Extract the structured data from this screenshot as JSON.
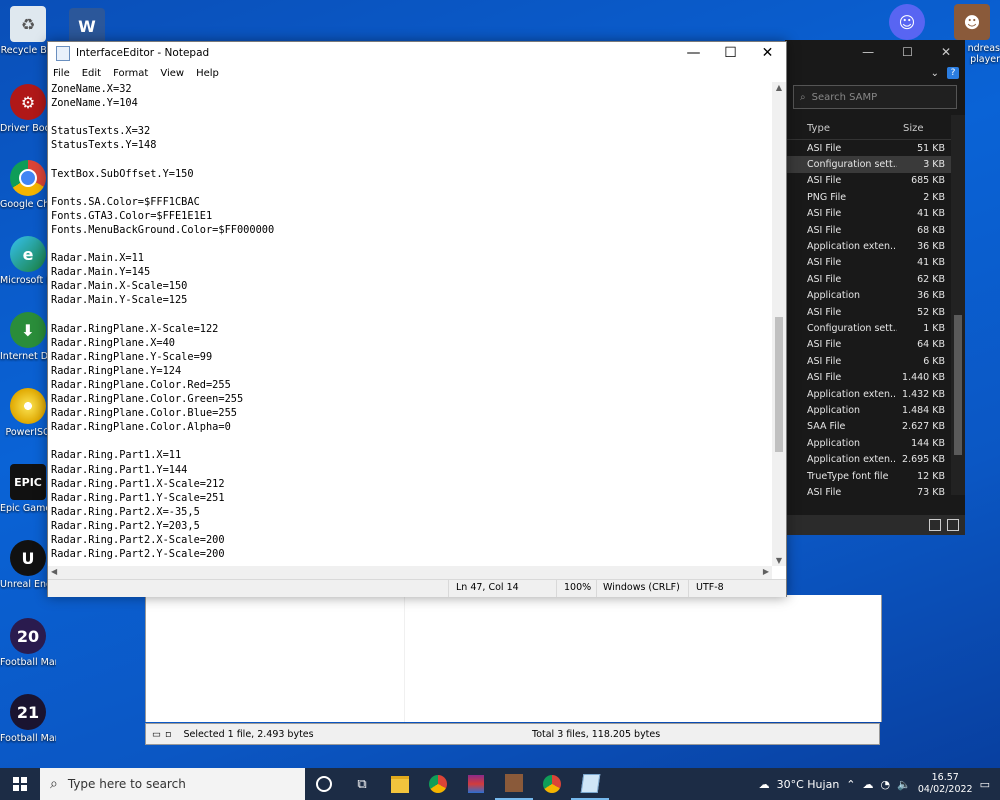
{
  "desktop": {
    "icons": [
      {
        "label": "Recycle Bin",
        "icon": "recycle-bin-icon"
      },
      {
        "label": "Driver Booster",
        "icon": "driver-booster-icon"
      },
      {
        "label": "Google Chrome",
        "icon": "chrome-icon"
      },
      {
        "label": "Microsoft Edge",
        "icon": "edge-icon"
      },
      {
        "label": "Internet Downlo...",
        "icon": "idm-icon"
      },
      {
        "label": "PowerISO",
        "icon": "poweriso-icon"
      },
      {
        "label": "Epic Games Launcher",
        "icon": "epic-games-icon",
        "badge": "EPIC"
      },
      {
        "label": "Unreal Engine",
        "icon": "unreal-engine-icon"
      },
      {
        "label": "Football Manag...",
        "icon": "football-manager-20-icon",
        "badge": "20"
      },
      {
        "label": "Football Manag...",
        "icon": "football-manager-21-icon",
        "badge": "21"
      }
    ],
    "top_icons": [
      {
        "label": "",
        "icon": "word-icon",
        "badge": "W"
      },
      {
        "label": "",
        "icon": "discord-icon"
      },
      {
        "label": "ndreas\nplayer",
        "icon": "samp-player-icon"
      }
    ]
  },
  "explorer": {
    "search_placeholder": "Search SAMP",
    "col_type": "Type",
    "col_size": "Size",
    "files": [
      {
        "type": "ASI File",
        "size": "51 KB"
      },
      {
        "type": "Configuration sett...",
        "size": "3 KB",
        "selected": true
      },
      {
        "type": "ASI File",
        "size": "685 KB"
      },
      {
        "type": "PNG File",
        "size": "2 KB"
      },
      {
        "type": "ASI File",
        "size": "41 KB"
      },
      {
        "type": "ASI File",
        "size": "68 KB"
      },
      {
        "type": "Application exten...",
        "size": "36 KB"
      },
      {
        "type": "ASI File",
        "size": "41 KB"
      },
      {
        "type": "ASI File",
        "size": "62 KB"
      },
      {
        "type": "Application",
        "size": "36 KB"
      },
      {
        "type": "ASI File",
        "size": "52 KB"
      },
      {
        "type": "Configuration sett...",
        "size": "1 KB"
      },
      {
        "type": "ASI File",
        "size": "64 KB"
      },
      {
        "type": "ASI File",
        "size": "6 KB"
      },
      {
        "type": "ASI File",
        "size": "1.440 KB"
      },
      {
        "type": "Application exten...",
        "size": "1.432 KB"
      },
      {
        "type": "Application",
        "size": "1.484 KB"
      },
      {
        "type": "SAA File",
        "size": "2.627 KB"
      },
      {
        "type": "Application",
        "size": "144 KB"
      },
      {
        "type": "Application exten...",
        "size": "2.695 KB"
      },
      {
        "type": "TrueType font file",
        "size": "12 KB"
      },
      {
        "type": "ASI File",
        "size": "73 KB"
      }
    ],
    "status_selected": "Selected 1 file, 2.493 bytes",
    "status_total": "Total 3 files, 118.205 bytes"
  },
  "notepad": {
    "title": "InterfaceEditor - Notepad",
    "menu": [
      "File",
      "Edit",
      "Format",
      "View",
      "Help"
    ],
    "content": "ZoneName.X=32\nZoneName.Y=104\n\nStatusTexts.X=32\nStatusTexts.Y=148\n\nTextBox.SubOffset.Y=150\n\nFonts.SA.Color=$FFF1CBAC\nFonts.GTA3.Color=$FFE1E1E1\nFonts.MenuBackGround.Color=$FF000000\n\nRadar.Main.X=11\nRadar.Main.Y=145\nRadar.Main.X-Scale=150\nRadar.Main.Y-Scale=125\n\nRadar.RingPlane.X-Scale=122\nRadar.RingPlane.X=40\nRadar.RingPlane.Y-Scale=99\nRadar.RingPlane.Y=124\nRadar.RingPlane.Color.Red=255\nRadar.RingPlane.Color.Green=255\nRadar.RingPlane.Color.Blue=255\nRadar.RingPlane.Color.Alpha=0\n\nRadar.Ring.Part1.X=11\nRadar.Ring.Part1.Y=144\nRadar.Ring.Part1.X-Scale=212\nRadar.Ring.Part1.Y-Scale=251\nRadar.Ring.Part2.X=-35,5\nRadar.Ring.Part2.Y=203,5\nRadar.Ring.Part2.X-Scale=200\nRadar.Ring.Part2.Y-Scale=200",
    "status": {
      "position": "Ln 47, Col 14",
      "zoom": "100%",
      "line_ending": "Windows (CRLF)",
      "encoding": "UTF-8"
    }
  },
  "taskbar": {
    "search_placeholder": "Type here to search",
    "weather": "30°C  Hujan",
    "time": "16.57",
    "date": "04/02/2022",
    "apps": [
      "cortana-icon",
      "task-view-icon",
      "file-explorer-icon",
      "chrome-icon",
      "winrar-icon",
      "samp-icon",
      "chrome-icon",
      "notepad-icon"
    ]
  },
  "colors": {
    "desktop": "#0a63d6",
    "taskbar": "#1c2c45",
    "explorer_dark": "#191919"
  }
}
